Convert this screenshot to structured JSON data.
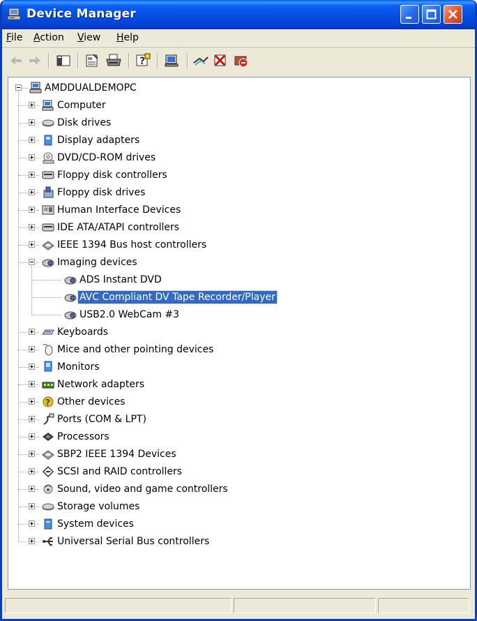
{
  "window": {
    "title": "Device Manager"
  },
  "menu": [
    {
      "key": "F",
      "rest": "ile"
    },
    {
      "key": "A",
      "rest": "ction"
    },
    {
      "key": "V",
      "rest": "iew"
    },
    {
      "key": "H",
      "rest": "elp"
    }
  ],
  "tree": {
    "root": "AMDDUALDEMOPC",
    "categories": [
      {
        "label": "Computer",
        "icon": "computer-icon"
      },
      {
        "label": "Disk drives",
        "icon": "disk-drive-icon"
      },
      {
        "label": "Display adapters",
        "icon": "display-adapter-icon"
      },
      {
        "label": "DVD/CD-ROM drives",
        "icon": "cdrom-icon"
      },
      {
        "label": "Floppy disk controllers",
        "icon": "controller-icon"
      },
      {
        "label": "Floppy disk drives",
        "icon": "floppy-drive-icon"
      },
      {
        "label": "Human Interface Devices",
        "icon": "hid-icon"
      },
      {
        "label": "IDE ATA/ATAPI controllers",
        "icon": "controller-icon"
      },
      {
        "label": "IEEE 1394 Bus host controllers",
        "icon": "ieee1394-icon"
      },
      {
        "label": "Imaging devices",
        "icon": "camera-icon",
        "expanded": true,
        "children": [
          "ADS Instant DVD",
          "AVC Compliant DV Tape Recorder/Player",
          "USB2.0 WebCam #3"
        ]
      },
      {
        "label": "Keyboards",
        "icon": "keyboard-icon"
      },
      {
        "label": "Mice and other pointing devices",
        "icon": "mouse-icon"
      },
      {
        "label": "Monitors",
        "icon": "monitor-icon"
      },
      {
        "label": "Network adapters",
        "icon": "network-adapter-icon"
      },
      {
        "label": "Other devices",
        "icon": "unknown-device-icon"
      },
      {
        "label": "Ports (COM & LPT)",
        "icon": "port-icon"
      },
      {
        "label": "Processors",
        "icon": "processor-icon"
      },
      {
        "label": "SBP2 IEEE 1394 Devices",
        "icon": "ieee1394-icon"
      },
      {
        "label": "SCSI and RAID controllers",
        "icon": "scsi-icon"
      },
      {
        "label": "Sound, video and game controllers",
        "icon": "sound-icon"
      },
      {
        "label": "Storage volumes",
        "icon": "disk-drive-icon"
      },
      {
        "label": "System devices",
        "icon": "system-device-icon"
      },
      {
        "label": "Universal Serial Bus controllers",
        "icon": "usb-icon"
      }
    ],
    "selected": "AVC Compliant DV Tape Recorder/Player"
  },
  "colors": {
    "titlebar": "#0550e4",
    "selection": "#316ac5",
    "window_bg": "#ece9d8"
  }
}
